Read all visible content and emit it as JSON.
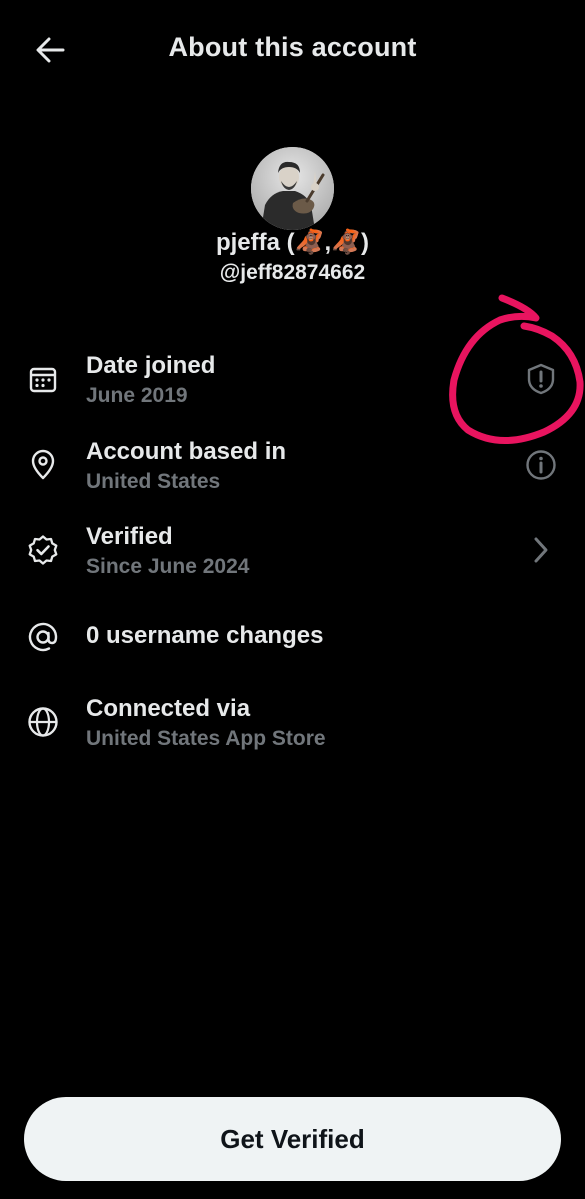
{
  "header": {
    "title": "About this account",
    "back_icon": "arrow-left-icon"
  },
  "profile": {
    "display_name": "pjeffa (🦧,🦧)",
    "handle": "@jeff82874662",
    "avatar": "black-and-white photo of a man with a violin"
  },
  "rows": [
    {
      "icon": "calendar-icon",
      "title": "Date joined",
      "subtitle": "June 2019",
      "action_icon": "shield-alert-icon"
    },
    {
      "icon": "location-pin-icon",
      "title": "Account based in",
      "subtitle": "United States",
      "action_icon": "info-icon"
    },
    {
      "icon": "verified-badge-icon",
      "title": "Verified",
      "subtitle": "Since June 2024",
      "action_icon": "chevron-right-icon"
    },
    {
      "icon": "at-sign-icon",
      "title": "0 username changes",
      "subtitle": "",
      "action_icon": ""
    },
    {
      "icon": "globe-icon",
      "title": "Connected via",
      "subtitle": "United States App Store",
      "action_icon": ""
    }
  ],
  "annotation": {
    "shape": "hand-drawn circle",
    "color": "#e8145f"
  },
  "cta": {
    "label": "Get Verified"
  },
  "colors": {
    "background": "#000000",
    "text_primary": "#e7e9ea",
    "text_secondary": "#71767b",
    "button_bg": "#eff3f4",
    "button_text": "#0f1419"
  }
}
